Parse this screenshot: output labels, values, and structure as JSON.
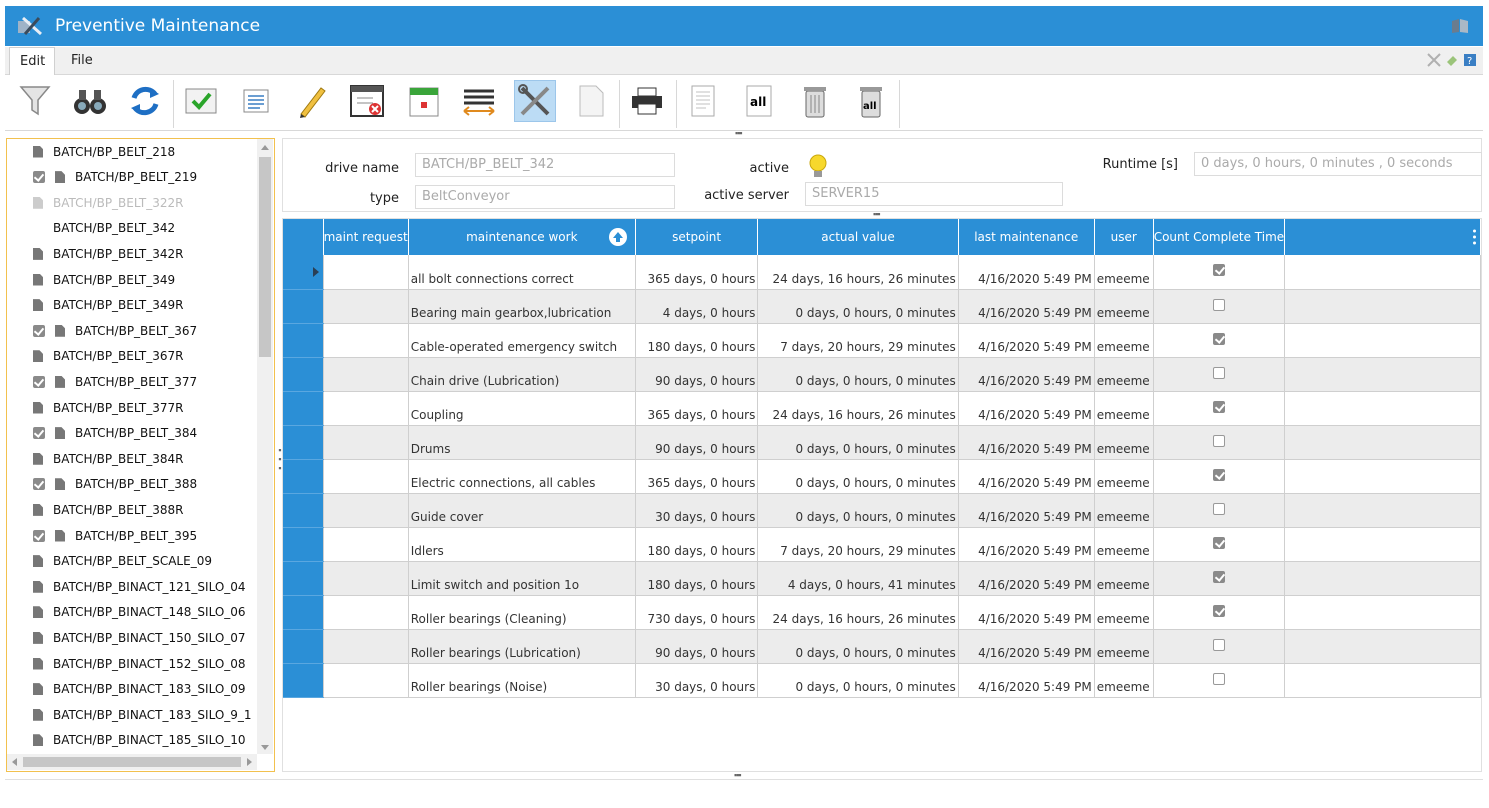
{
  "window": {
    "title": "Preventive Maintenance"
  },
  "menu": {
    "edit": "Edit",
    "file": "File"
  },
  "toolbar": {
    "buttons": [
      "filter-icon",
      "binoculars-icon",
      "refresh-icon",
      "approve-icon",
      "text-list-icon",
      "pencil-icon",
      "delete-window-icon",
      "calendar-icon",
      "lines-icon",
      "tools-icon",
      "blank-page-icon",
      "printer-icon",
      "report-icon",
      "all-icon",
      "trash-icon",
      "trash-all-icon"
    ],
    "all_label": "all"
  },
  "tree": {
    "items": [
      {
        "label": "BATCH/BP_BELT_218",
        "checked": false,
        "disabled": false,
        "doc": true
      },
      {
        "label": "BATCH/BP_BELT_219",
        "checked": true,
        "disabled": false,
        "doc": true
      },
      {
        "label": "BATCH/BP_BELT_322R",
        "checked": false,
        "disabled": true,
        "doc": true
      },
      {
        "label": "BATCH/BP_BELT_342",
        "checked": false,
        "disabled": false,
        "doc": false
      },
      {
        "label": "BATCH/BP_BELT_342R",
        "checked": false,
        "disabled": false,
        "doc": true
      },
      {
        "label": "BATCH/BP_BELT_349",
        "checked": false,
        "disabled": false,
        "doc": true
      },
      {
        "label": "BATCH/BP_BELT_349R",
        "checked": false,
        "disabled": false,
        "doc": true
      },
      {
        "label": "BATCH/BP_BELT_367",
        "checked": true,
        "disabled": false,
        "doc": true
      },
      {
        "label": "BATCH/BP_BELT_367R",
        "checked": false,
        "disabled": false,
        "doc": true
      },
      {
        "label": "BATCH/BP_BELT_377",
        "checked": true,
        "disabled": false,
        "doc": true
      },
      {
        "label": "BATCH/BP_BELT_377R",
        "checked": false,
        "disabled": false,
        "doc": true
      },
      {
        "label": "BATCH/BP_BELT_384",
        "checked": true,
        "disabled": false,
        "doc": true
      },
      {
        "label": "BATCH/BP_BELT_384R",
        "checked": false,
        "disabled": false,
        "doc": true
      },
      {
        "label": "BATCH/BP_BELT_388",
        "checked": true,
        "disabled": false,
        "doc": true
      },
      {
        "label": "BATCH/BP_BELT_388R",
        "checked": false,
        "disabled": false,
        "doc": true
      },
      {
        "label": "BATCH/BP_BELT_395",
        "checked": true,
        "disabled": false,
        "doc": true
      },
      {
        "label": "BATCH/BP_BELT_SCALE_09",
        "checked": false,
        "disabled": false,
        "doc": true
      },
      {
        "label": "BATCH/BP_BINACT_121_SILO_04",
        "checked": false,
        "disabled": false,
        "doc": true
      },
      {
        "label": "BATCH/BP_BINACT_148_SILO_06",
        "checked": false,
        "disabled": false,
        "doc": true
      },
      {
        "label": "BATCH/BP_BINACT_150_SILO_07",
        "checked": false,
        "disabled": false,
        "doc": true
      },
      {
        "label": "BATCH/BP_BINACT_152_SILO_08",
        "checked": false,
        "disabled": false,
        "doc": true
      },
      {
        "label": "BATCH/BP_BINACT_183_SILO_09",
        "checked": false,
        "disabled": false,
        "doc": true
      },
      {
        "label": "BATCH/BP_BINACT_183_SILO_9_1",
        "checked": false,
        "disabled": false,
        "doc": true
      },
      {
        "label": "BATCH/BP_BINACT_185_SILO_10",
        "checked": false,
        "disabled": false,
        "doc": true
      }
    ]
  },
  "info": {
    "drive_name_label": "drive name",
    "drive_name_value": "BATCH/BP_BELT_342",
    "type_label": "type",
    "type_value": "BeltConveyor",
    "active_label": "active",
    "active_server_label": "active server",
    "active_server_value": "SERVER15",
    "runtime_label": "Runtime [s]",
    "runtime_value": "0 days, 0 hours, 0 minutes , 0 seconds"
  },
  "table": {
    "headers": [
      "maint request",
      "maintenance work",
      "setpoint",
      "actual value",
      "last maintenance",
      "user",
      "Count Complete Time"
    ],
    "rows": [
      {
        "work": "all bolt connections correct",
        "setpoint": "365 days, 0 hours",
        "actual": "24 days, 16 hours, 26 minutes",
        "last": "4/16/2020 5:49 PM",
        "user": "emeeme",
        "count": true
      },
      {
        "work": "Bearing main gearbox,lubrication",
        "setpoint": "4 days, 0 hours",
        "actual": "0 days, 0 hours, 0 minutes",
        "last": "4/16/2020 5:49 PM",
        "user": "emeeme",
        "count": false
      },
      {
        "work": "Cable-operated emergency switch",
        "setpoint": "180 days, 0 hours",
        "actual": "7 days, 20 hours, 29 minutes",
        "last": "4/16/2020 5:49 PM",
        "user": "emeeme",
        "count": true
      },
      {
        "work": "Chain drive (Lubrication)",
        "setpoint": "90 days, 0 hours",
        "actual": "0 days, 0 hours, 0 minutes",
        "last": "4/16/2020 5:49 PM",
        "user": "emeeme",
        "count": false
      },
      {
        "work": "Coupling",
        "setpoint": "365 days, 0 hours",
        "actual": "24 days, 16 hours, 26 minutes",
        "last": "4/16/2020 5:49 PM",
        "user": "emeeme",
        "count": true
      },
      {
        "work": "Drums",
        "setpoint": "90 days, 0 hours",
        "actual": "0 days, 0 hours, 0 minutes",
        "last": "4/16/2020 5:49 PM",
        "user": "emeeme",
        "count": false
      },
      {
        "work": "Electric connections, all cables",
        "setpoint": "365 days, 0 hours",
        "actual": "0 days, 0 hours, 0 minutes",
        "last": "4/16/2020 5:49 PM",
        "user": "emeeme",
        "count": true
      },
      {
        "work": "Guide cover",
        "setpoint": "30 days, 0 hours",
        "actual": "0 days, 0 hours, 0 minutes",
        "last": "4/16/2020 5:49 PM",
        "user": "emeeme",
        "count": false
      },
      {
        "work": "Idlers",
        "setpoint": "180 days, 0 hours",
        "actual": "7 days, 20 hours, 29 minutes",
        "last": "4/16/2020 5:49 PM",
        "user": "emeeme",
        "count": true
      },
      {
        "work": "Limit switch and position 1o",
        "setpoint": "180 days, 0 hours",
        "actual": "4 days, 0 hours, 41 minutes",
        "last": "4/16/2020 5:49 PM",
        "user": "emeeme",
        "count": true
      },
      {
        "work": "Roller bearings (Cleaning)",
        "setpoint": "730 days, 0 hours",
        "actual": "24 days, 16 hours, 26 minutes",
        "last": "4/16/2020 5:49 PM",
        "user": "emeeme",
        "count": true
      },
      {
        "work": "Roller bearings (Lubrication)",
        "setpoint": "90 days, 0 hours",
        "actual": "0 days, 0 hours, 0 minutes",
        "last": "4/16/2020 5:49 PM",
        "user": "emeeme",
        "count": false
      },
      {
        "work": "Roller bearings (Noise)",
        "setpoint": "30 days, 0 hours",
        "actual": "0 days, 0 hours, 0 minutes",
        "last": "4/16/2020 5:49 PM",
        "user": "emeeme",
        "count": false
      }
    ]
  },
  "colors": {
    "accent": "#2b8fd6",
    "panel_border": "#f2c14e",
    "row_alt": "#ececec"
  }
}
